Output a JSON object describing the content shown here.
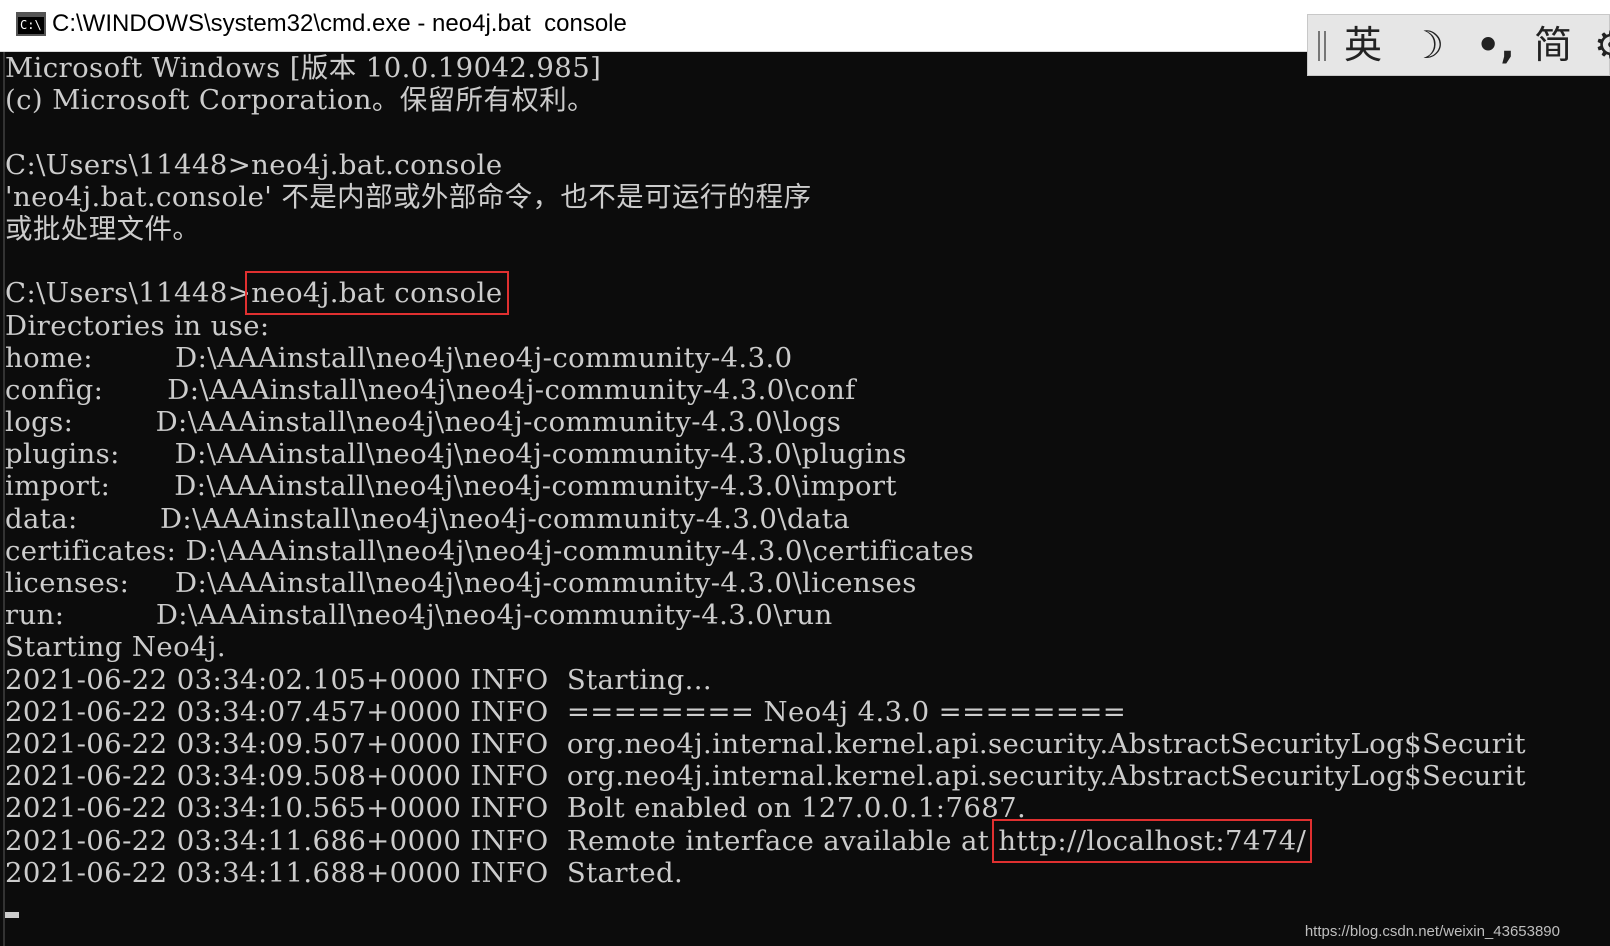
{
  "window": {
    "title": "C:\\WINDOWS\\system32\\cmd.exe - neo4j.bat  console",
    "icon": "cmd-terminal-icon"
  },
  "ime_toolbar": {
    "items": [
      "英",
      "☽",
      "•,",
      "简",
      "⚙"
    ]
  },
  "console": {
    "lines": [
      "Microsoft Windows [版本 10.0.19042.985]",
      "(c) Microsoft Corporation。保留所有权利。",
      "",
      "C:\\Users\\11448>neo4j.bat.console",
      "'neo4j.bat.console' 不是内部或外部命令，也不是可运行的程序",
      "或批处理文件。",
      "",
      "C:\\Users\\11448>",
      "Directories in use:",
      "home:         D:\\AAAinstall\\neo4j\\neo4j-community-4.3.0",
      "config:       D:\\AAAinstall\\neo4j\\neo4j-community-4.3.0\\conf",
      "logs:         D:\\AAAinstall\\neo4j\\neo4j-community-4.3.0\\logs",
      "plugins:      D:\\AAAinstall\\neo4j\\neo4j-community-4.3.0\\plugins",
      "import:       D:\\AAAinstall\\neo4j\\neo4j-community-4.3.0\\import",
      "data:         D:\\AAAinstall\\neo4j\\neo4j-community-4.3.0\\data",
      "certificates: D:\\AAAinstall\\neo4j\\neo4j-community-4.3.0\\certificates",
      "licenses:     D:\\AAAinstall\\neo4j\\neo4j-community-4.3.0\\licenses",
      "run:          D:\\AAAinstall\\neo4j\\neo4j-community-4.3.0\\run",
      "Starting Neo4j.",
      "2021-06-22 03:34:02.105+0000 INFO  Starting...",
      "2021-06-22 03:34:07.457+0000 INFO  ======== Neo4j 4.3.0 ========",
      "2021-06-22 03:34:09.507+0000 INFO  org.neo4j.internal.kernel.api.security.AbstractSecurityLog$Securit",
      "2021-06-22 03:34:09.508+0000 INFO  org.neo4j.internal.kernel.api.security.AbstractSecurityLog$Securit",
      "2021-06-22 03:34:10.565+0000 INFO  Bolt enabled on 127.0.0.1:7687.",
      "2021-06-22 03:34:11.686+0000 INFO  Remote interface available at ",
      "2021-06-22 03:34:11.688+0000 INFO  Started."
    ],
    "highlight_command": "neo4j.bat console",
    "highlight_url": "http://localhost:7474/"
  },
  "watermark": "https://blog.csdn.net/weixin_43653890",
  "colors": {
    "console_bg": "#0c0c0c",
    "console_fg": "#cccccc",
    "highlight_box": "#e03030"
  }
}
